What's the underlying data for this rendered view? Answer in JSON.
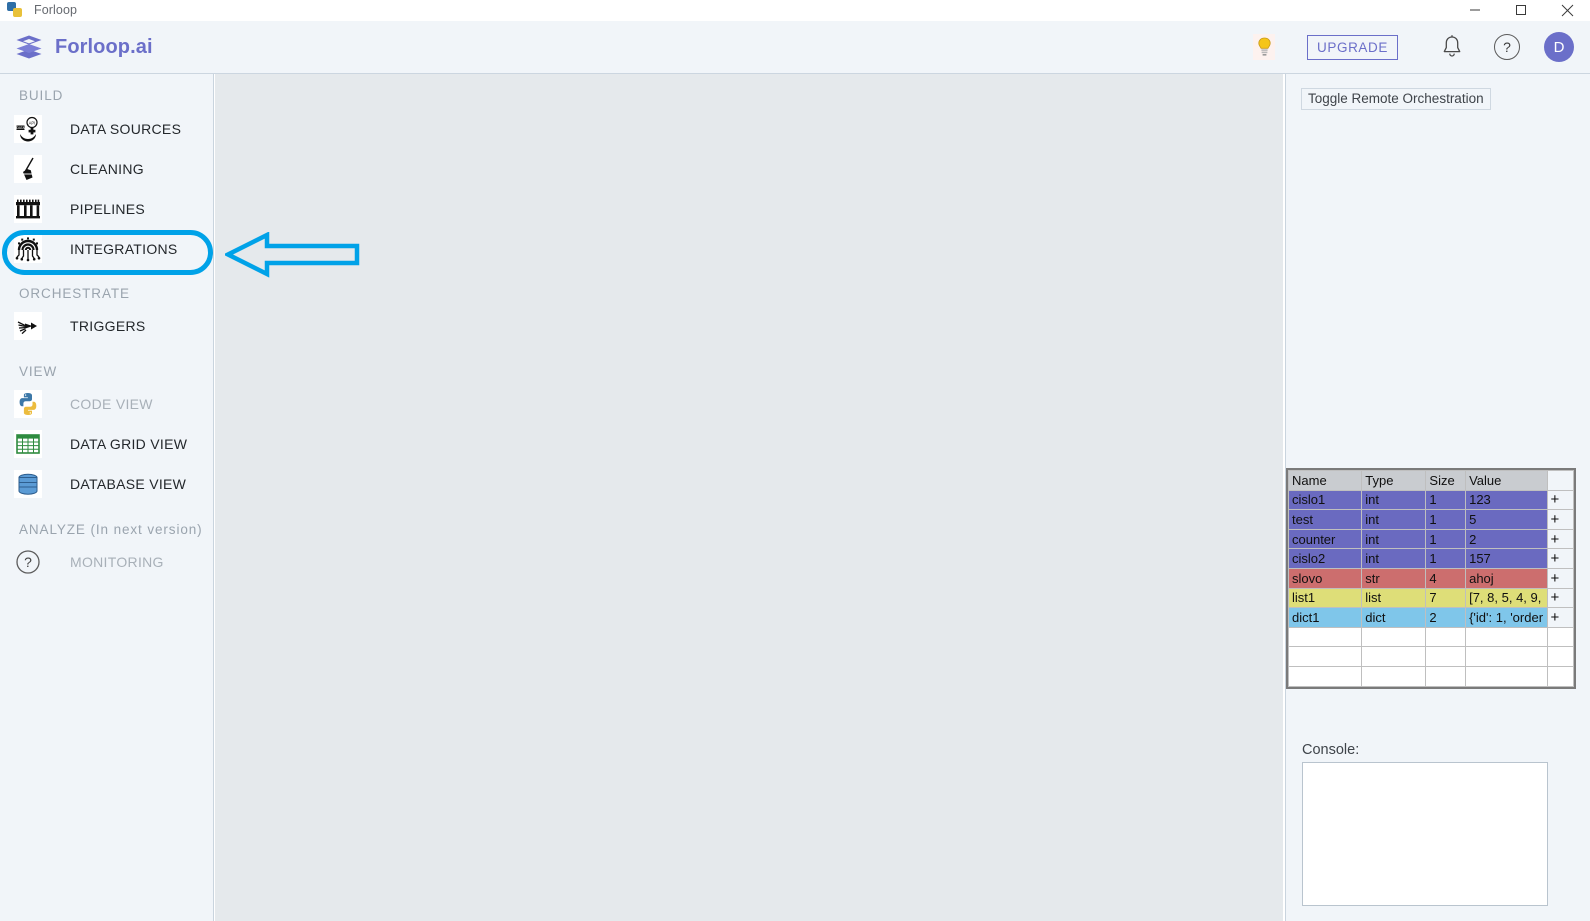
{
  "window": {
    "title": "Forloop",
    "icon": "python-icon",
    "controls": [
      {
        "name": "minimize-button",
        "glyph": "minimize-icon"
      },
      {
        "name": "maximize-button",
        "glyph": "maximize-icon"
      },
      {
        "name": "close-button",
        "glyph": "close-icon"
      }
    ]
  },
  "header": {
    "brand": "Forloop.ai",
    "logo_icon": "forloop-stacked-hexagon-logo",
    "brand_color": "#6b6fc9",
    "bulb_icon": "lightbulb-icon",
    "upgrade_label": "UPGRADE",
    "bell_icon": "bell-icon",
    "help_label": "?",
    "avatar_initial": "D"
  },
  "sidebar": {
    "sections": [
      {
        "label": "BUILD",
        "items": [
          {
            "label": "DATA SOURCES",
            "icon": "data-sources-icon",
            "state": "enabled"
          },
          {
            "label": "CLEANING",
            "icon": "broom-icon",
            "state": "enabled"
          },
          {
            "label": "PIPELINES",
            "icon": "pipelines-icon",
            "state": "enabled"
          },
          {
            "label": "INTEGRATIONS",
            "icon": "integrations-icon",
            "state": "highlighted"
          }
        ]
      },
      {
        "label": "ORCHESTRATE",
        "items": [
          {
            "label": "TRIGGERS",
            "icon": "triggers-icon",
            "state": "enabled"
          }
        ]
      },
      {
        "label": "VIEW",
        "items": [
          {
            "label": "CODE VIEW",
            "icon": "python-icon",
            "state": "disabled"
          },
          {
            "label": "DATA GRID VIEW",
            "icon": "grid-icon",
            "state": "enabled"
          },
          {
            "label": "DATABASE VIEW",
            "icon": "database-icon",
            "state": "enabled"
          }
        ]
      },
      {
        "label": "ANALYZE (In next version)",
        "items": [
          {
            "label": "MONITORING",
            "icon": "question-circle-icon",
            "state": "disabled"
          }
        ]
      }
    ]
  },
  "right_panel": {
    "toggle_remote_label": "Toggle Remote Orchestration",
    "console_label": "Console:",
    "console_value": "",
    "variables": {
      "columns": [
        "Name",
        "Type",
        "Size",
        "Value"
      ],
      "add_glyph": "+",
      "rows": [
        {
          "name": "cislo1",
          "type": "int",
          "size": "1",
          "value": "123",
          "kind": "int"
        },
        {
          "name": "test",
          "type": "int",
          "size": "1",
          "value": "5",
          "kind": "int"
        },
        {
          "name": "counter",
          "type": "int",
          "size": "1",
          "value": "2",
          "kind": "int"
        },
        {
          "name": "cislo2",
          "type": "int",
          "size": "1",
          "value": "157",
          "kind": "int"
        },
        {
          "name": "slovo",
          "type": "str",
          "size": "4",
          "value": "ahoj",
          "kind": "str"
        },
        {
          "name": "list1",
          "type": "list",
          "size": "7",
          "value": "[7, 8, 5, 4, 9,",
          "kind": "list"
        },
        {
          "name": "dict1",
          "type": "dict",
          "size": "2",
          "value": "{'id': 1, 'order",
          "kind": "dict"
        },
        {
          "name": "",
          "type": "",
          "size": "",
          "value": "",
          "kind": "empty"
        },
        {
          "name": "",
          "type": "",
          "size": "",
          "value": "",
          "kind": "empty"
        },
        {
          "name": "",
          "type": "",
          "size": "",
          "value": "",
          "kind": "empty"
        }
      ],
      "type_colors": {
        "int": "#6a6ac0",
        "str": "#cc6e6e",
        "list": "#dede78",
        "dict": "#7fc6ea",
        "header": "#c9ccd0"
      }
    }
  },
  "annotations": {
    "highlight_target": "INTEGRATIONS",
    "highlight_color": "#00a2e8",
    "arrow_icon": "left-arrow-annotation",
    "arrow_color": "#00a2e8"
  }
}
